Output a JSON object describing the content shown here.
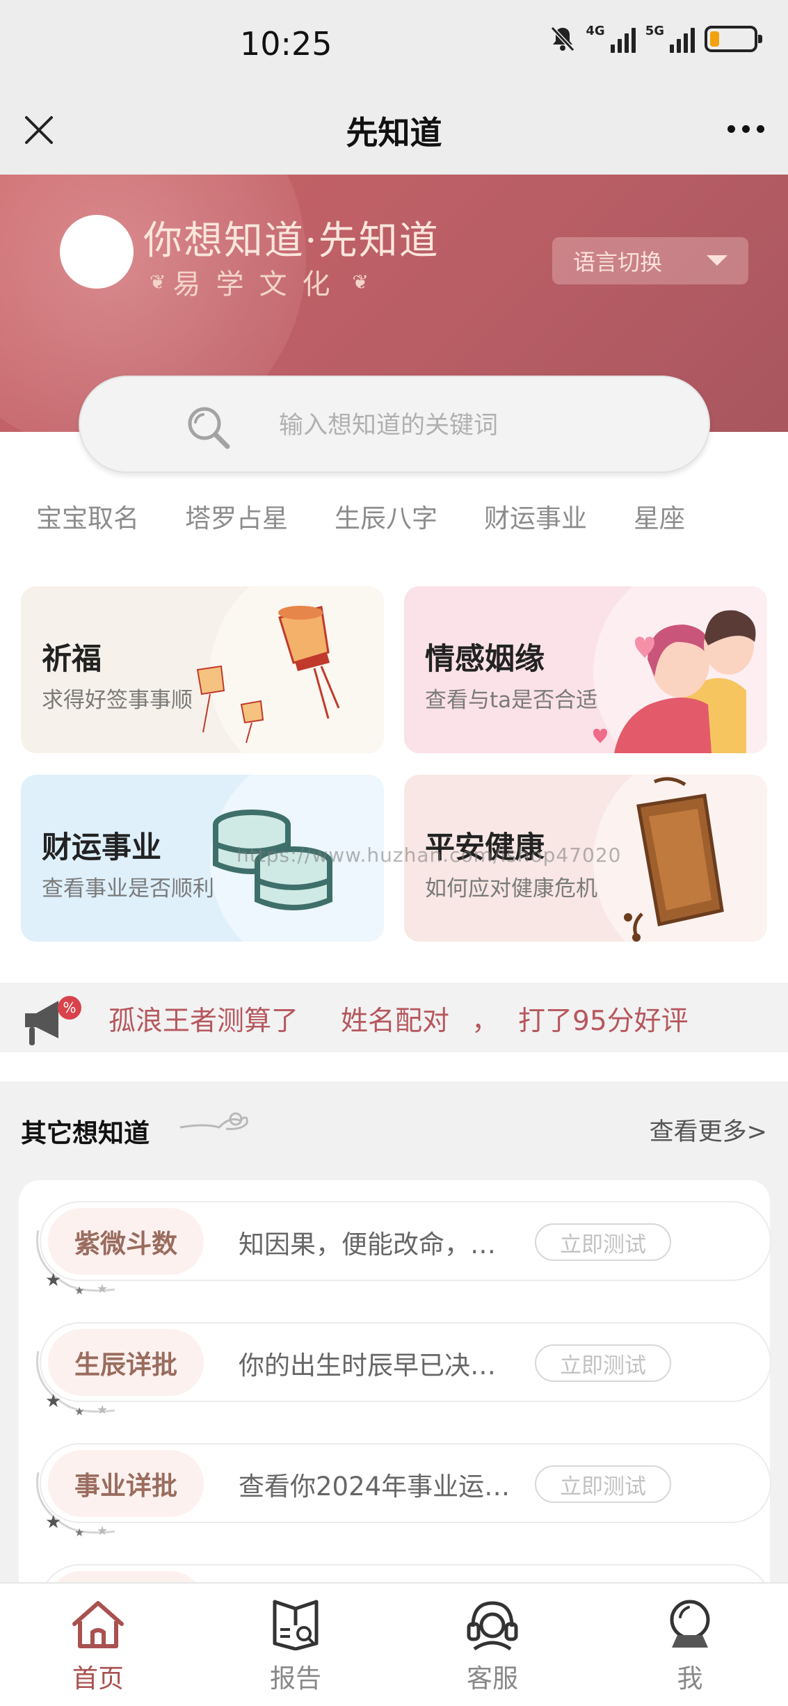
{
  "status_bar": {
    "time": "10:25",
    "net1": "4G",
    "net2": "5G"
  },
  "header": {
    "title": "先知道"
  },
  "banner": {
    "slogan": "你想知道·先知道",
    "subtitle": "易学文化",
    "language_button": "语言切换"
  },
  "search": {
    "placeholder": "输入想知道的关键词"
  },
  "hot_tags": [
    "宝宝取名",
    "塔罗占星",
    "生辰八字",
    "财运事业",
    "星座"
  ],
  "categories": [
    {
      "title": "祈福",
      "subtitle": "求得好签事事顺"
    },
    {
      "title": "情感姻缘",
      "subtitle": "查看与ta是否合适"
    },
    {
      "title": "财运事业",
      "subtitle": "查看事业是否顺利"
    },
    {
      "title": "平安健康",
      "subtitle": "如何应对健康危机"
    }
  ],
  "watermark": "https://www.huzhan.com/ishop47020",
  "notice": {
    "badge": "%",
    "user": "孤浪王者测算了",
    "item": "姓名配对",
    "sep": "，",
    "rating": "打了95分好评"
  },
  "other": {
    "title": "其它想知道",
    "more": "查看更多>",
    "items": [
      {
        "name": "紫微斗数",
        "desc": "知因果，便能改命，…",
        "action": "立即测试"
      },
      {
        "name": "生辰详批",
        "desc": "你的出生时辰早已决…",
        "action": "立即测试"
      },
      {
        "name": "事业详批",
        "desc": "查看你2024年事业运…",
        "action": "立即测试"
      }
    ]
  },
  "tabbar": [
    {
      "label": "首页",
      "active": true
    },
    {
      "label": "报告",
      "active": false
    },
    {
      "label": "客服",
      "active": false
    },
    {
      "label": "我",
      "active": false
    }
  ],
  "colors": {
    "banner": "#c96468",
    "accent": "#a8514f",
    "notice_text": "#b6575d",
    "battery": "#f2a20c"
  }
}
